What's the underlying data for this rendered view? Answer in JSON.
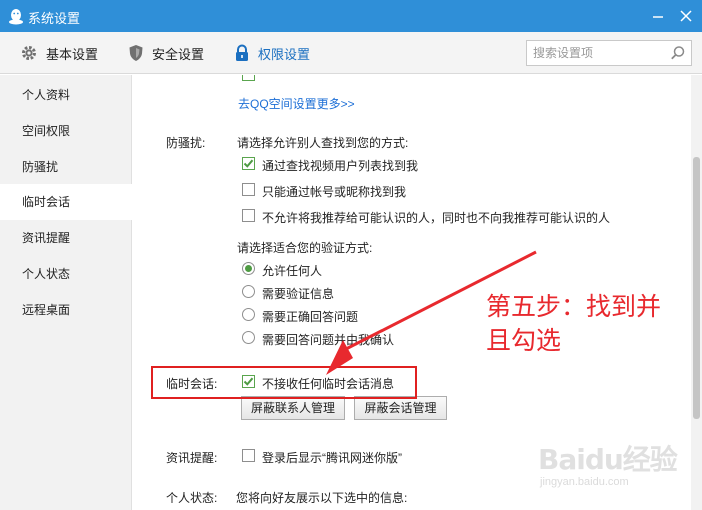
{
  "window": {
    "title": "系统设置"
  },
  "toolbar": {
    "tabs": [
      {
        "label": "基本设置",
        "icon": "gear-icon"
      },
      {
        "label": "安全设置",
        "icon": "shield-icon"
      },
      {
        "label": "权限设置",
        "icon": "lock-icon",
        "active": true
      }
    ],
    "search_placeholder": "搜索设置项"
  },
  "sidebar": {
    "items": [
      {
        "label": "个人资料"
      },
      {
        "label": "空间权限"
      },
      {
        "label": "防骚扰"
      },
      {
        "label": "临时会话",
        "active": true
      },
      {
        "label": "资讯提醒"
      },
      {
        "label": "个人状态"
      },
      {
        "label": "远程桌面"
      }
    ]
  },
  "content": {
    "qzone_link": "去QQ空间设置更多>>",
    "anti_harass": {
      "label": "防骚扰:",
      "find_prompt": "请选择允许别人查找到您的方式:",
      "options": [
        {
          "label": "通过查找视频用户列表找到我",
          "checked": true
        },
        {
          "label": "只能通过帐号或昵称找到我",
          "checked": false
        },
        {
          "label": "不允许将我推荐给可能认识的人，同时也不向我推荐可能认识的人",
          "checked": false
        }
      ],
      "verify_prompt": "请选择适合您的验证方式:",
      "verify_options": [
        {
          "label": "允许任何人",
          "selected": true
        },
        {
          "label": "需要验证信息",
          "selected": false
        },
        {
          "label": "需要正确回答问题",
          "selected": false
        },
        {
          "label": "需要回答问题并由我确认",
          "selected": false
        }
      ]
    },
    "temp_session": {
      "label": "临时会话:",
      "option": {
        "label": "不接收任何临时会话消息",
        "checked": true
      },
      "buttons": [
        "屏蔽联系人管理",
        "屏蔽会话管理"
      ]
    },
    "news": {
      "label": "资讯提醒:",
      "option": {
        "label": "登录后显示“腾讯网迷你版”",
        "checked": false
      }
    },
    "status": {
      "label": "个人状态:",
      "text": "您将向好友展示以下选中的信息:"
    }
  },
  "annotation": {
    "line1": "第五步：找到并",
    "line2": "且勾选"
  },
  "watermark": {
    "brand": "Baidu经验",
    "sub": "jingyan.baidu.com"
  },
  "colors": {
    "titlebar": "#2f8fd8",
    "accent": "#1b6fc0",
    "check": "#4e9b43",
    "annotation": "#e8292e"
  }
}
